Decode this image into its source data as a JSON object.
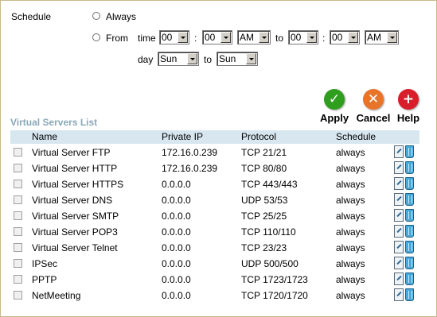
{
  "schedule": {
    "label": "Schedule",
    "always_label": "Always",
    "from_label": "From",
    "time_label": "time",
    "to_label": "to",
    "day_label": "day",
    "colon": ":",
    "start_hour": "00",
    "start_minute": "00",
    "start_ampm": "AM",
    "end_hour": "00",
    "end_minute": "00",
    "end_ampm": "AM",
    "day_from": "Sun",
    "day_to": "Sun"
  },
  "actions": {
    "apply": "Apply",
    "cancel": "Cancel",
    "help": "Help"
  },
  "colors": {
    "apply": "#2f9e1f",
    "cancel": "#e8742a",
    "help": "#d81e2a",
    "header_bg": "#d8e6f0",
    "list_title": "#8aa8b8"
  },
  "list": {
    "title": "Virtual Servers List",
    "columns": [
      "Name",
      "Private IP",
      "Protocol",
      "Schedule"
    ],
    "rows": [
      {
        "name": "Virtual Server FTP",
        "ip": "172.16.0.239",
        "protocol": "TCP 21/21",
        "schedule": "always"
      },
      {
        "name": "Virtual Server HTTP",
        "ip": "172.16.0.239",
        "protocol": "TCP 80/80",
        "schedule": "always"
      },
      {
        "name": "Virtual Server HTTPS",
        "ip": "0.0.0.0",
        "protocol": "TCP 443/443",
        "schedule": "always"
      },
      {
        "name": "Virtual Server DNS",
        "ip": "0.0.0.0",
        "protocol": "UDP 53/53",
        "schedule": "always"
      },
      {
        "name": "Virtual Server SMTP",
        "ip": "0.0.0.0",
        "protocol": "TCP 25/25",
        "schedule": "always"
      },
      {
        "name": "Virtual Server POP3",
        "ip": "0.0.0.0",
        "protocol": "TCP 110/110",
        "schedule": "always"
      },
      {
        "name": "Virtual Server Telnet",
        "ip": "0.0.0.0",
        "protocol": "TCP 23/23",
        "schedule": "always"
      },
      {
        "name": "IPSec",
        "ip": "0.0.0.0",
        "protocol": "UDP 500/500",
        "schedule": "always"
      },
      {
        "name": "PPTP",
        "ip": "0.0.0.0",
        "protocol": "TCP 1723/1723",
        "schedule": "always"
      },
      {
        "name": "NetMeeting",
        "ip": "0.0.0.0",
        "protocol": "TCP 1720/1720",
        "schedule": "always"
      }
    ]
  }
}
